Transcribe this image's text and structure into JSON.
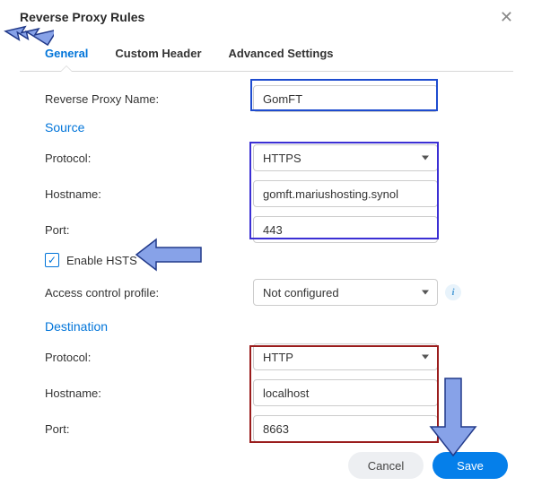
{
  "titlebar": {
    "title": "Reverse Proxy Rules"
  },
  "tabs": {
    "general": "General",
    "custom_header": "Custom Header",
    "advanced": "Advanced Settings"
  },
  "form": {
    "name_label": "Reverse Proxy Name:",
    "name_value": "GomFT",
    "source_title": "Source",
    "src_protocol_label": "Protocol:",
    "src_protocol_value": "HTTPS",
    "src_host_label": "Hostname:",
    "src_host_value": "gomft.mariushosting.synol",
    "src_port_label": "Port:",
    "src_port_value": "443",
    "hsts_label": "Enable HSTS",
    "acp_label": "Access control profile:",
    "acp_value": "Not configured",
    "dest_title": "Destination",
    "dst_protocol_label": "Protocol:",
    "dst_protocol_value": "HTTP",
    "dst_host_label": "Hostname:",
    "dst_host_value": "localhost",
    "dst_port_label": "Port:",
    "dst_port_value": "8663"
  },
  "buttons": {
    "cancel": "Cancel",
    "save": "Save"
  }
}
